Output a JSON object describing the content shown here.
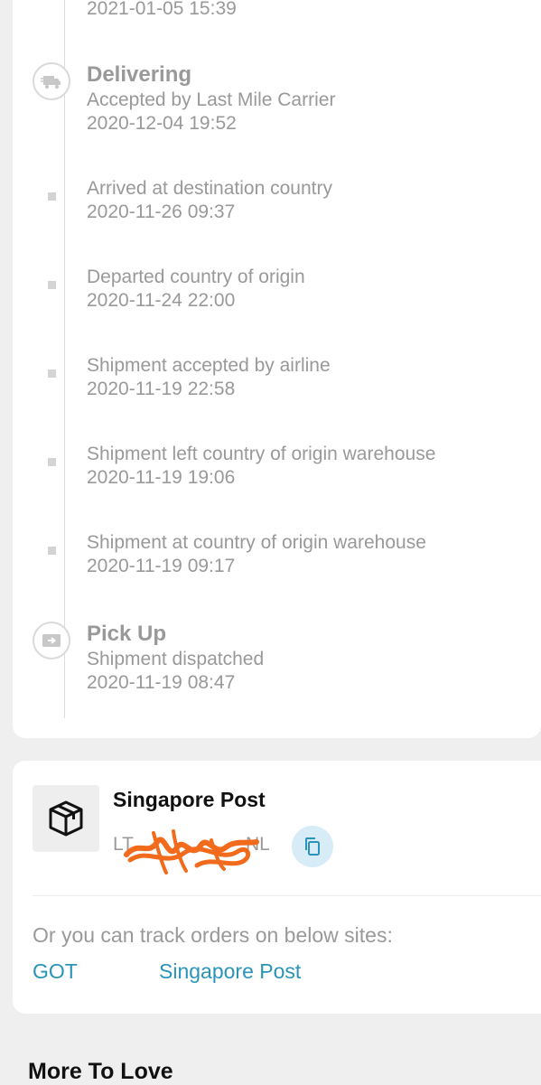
{
  "timeline": {
    "events": [
      {
        "title": "",
        "description": "",
        "time": "2021-01-05 15:39"
      },
      {
        "title": "Delivering",
        "description": "Accepted by Last Mile Carrier",
        "time": "2020-12-04 19:52",
        "icon": "delivery-truck-icon"
      },
      {
        "title": "",
        "description": "Arrived at destination country",
        "time": "2020-11-26 09:37"
      },
      {
        "title": "",
        "description": "Departed country of origin",
        "time": "2020-11-24 22:00"
      },
      {
        "title": "",
        "description": "Shipment accepted by airline",
        "time": "2020-11-19 22:58"
      },
      {
        "title": "",
        "description": "Shipment left country of origin warehouse",
        "time": "2020-11-19 19:06"
      },
      {
        "title": "",
        "description": "Shipment at country of origin warehouse",
        "time": "2020-11-19 09:17"
      },
      {
        "title": "Pick Up",
        "description": "Shipment dispatched",
        "time": "2020-11-19 08:47",
        "icon": "pickup-box-icon"
      }
    ]
  },
  "carrier": {
    "logo_icon": "package-box-icon",
    "name": "Singapore Post",
    "tracking_prefix": "LT",
    "tracking_suffix": "NL",
    "copy_icon": "copy-icon"
  },
  "other_sites": {
    "hint": "Or you can track orders on below sites:",
    "links": [
      {
        "label": "GOT"
      },
      {
        "label": "Singapore Post"
      }
    ]
  },
  "section": {
    "more_to_love": "More To Love"
  },
  "colors": {
    "link": "#2a93b8",
    "muted_text": "#999999",
    "copy_button_bg": "#d7ecf7",
    "redaction": "#f26a1b"
  }
}
